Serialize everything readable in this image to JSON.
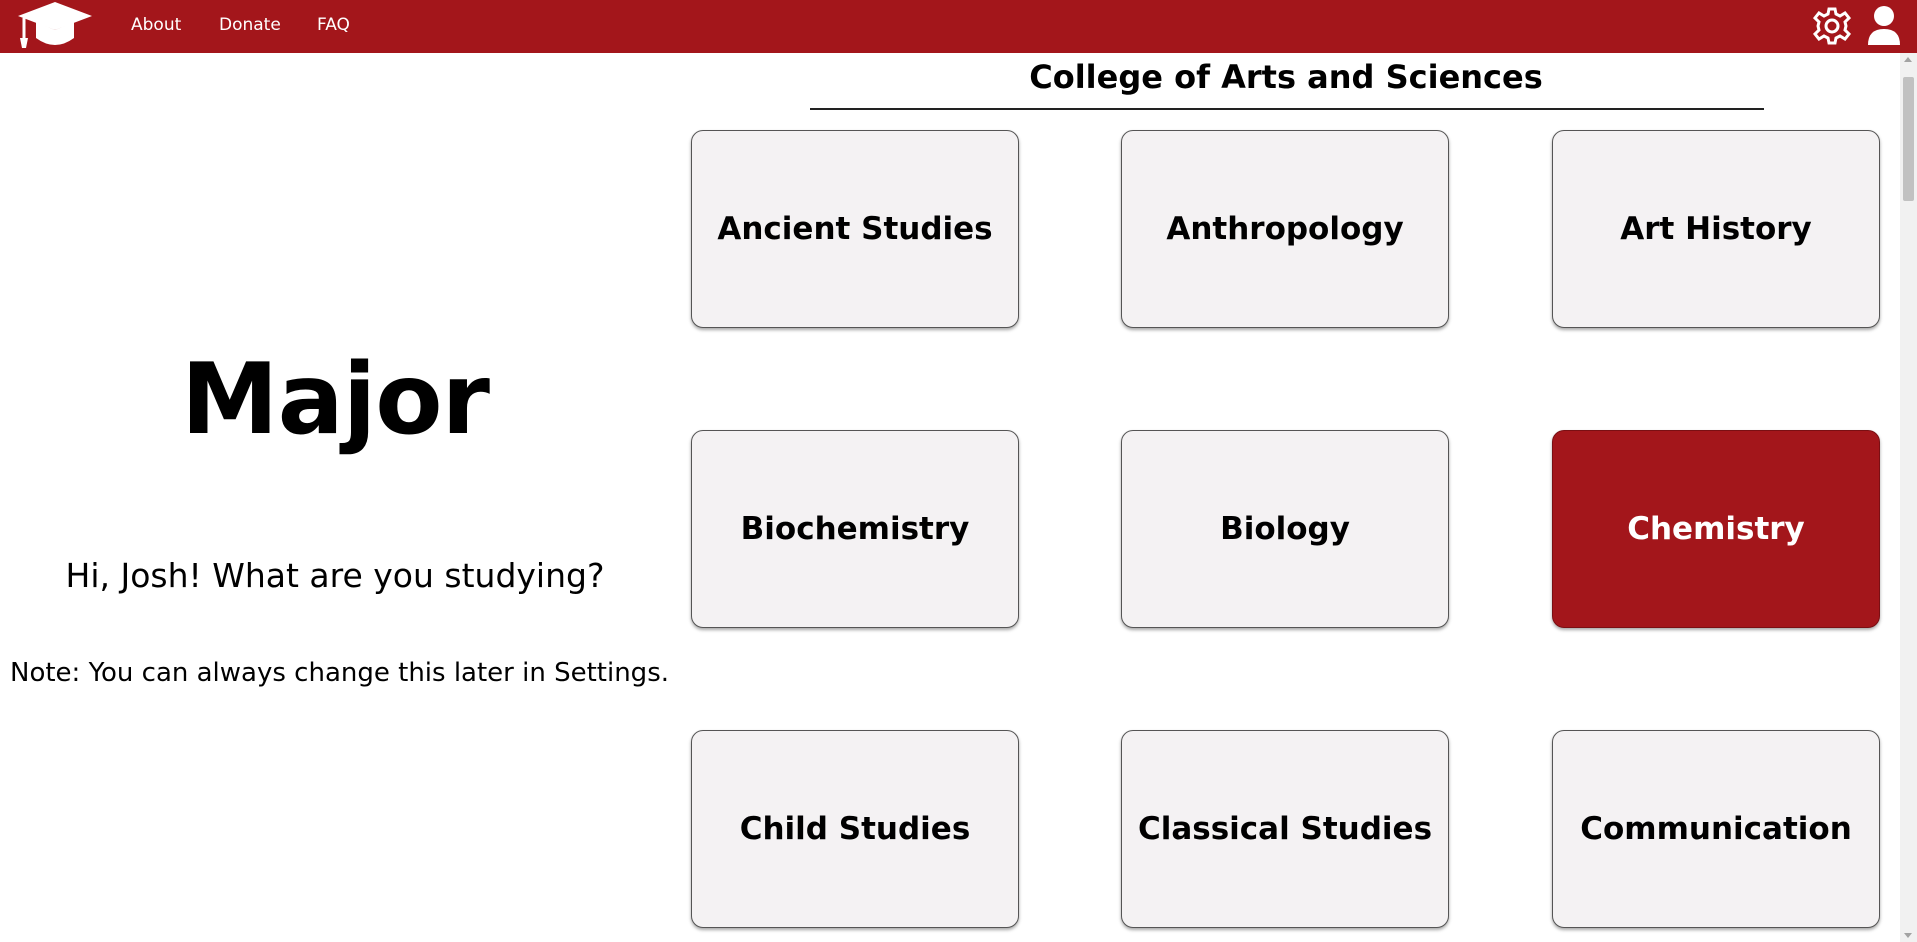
{
  "nav": {
    "logo_icon": "graduation-cap-icon",
    "links": [
      "About",
      "Donate",
      "FAQ"
    ],
    "settings_icon": "gear-icon",
    "account_icon": "user-icon",
    "brand_color": "#a3161b"
  },
  "left": {
    "title": "Major",
    "greeting": "Hi, Josh! What are you studying?",
    "note": "Note: You can always change this later in Settings."
  },
  "section": {
    "title": "College of Arts and Sciences"
  },
  "majors": [
    {
      "label": "Ancient Studies",
      "selected": false
    },
    {
      "label": "Anthropology",
      "selected": false
    },
    {
      "label": "Art History",
      "selected": false
    },
    {
      "label": "Biochemistry",
      "selected": false
    },
    {
      "label": "Biology",
      "selected": false
    },
    {
      "label": "Chemistry",
      "selected": true
    },
    {
      "label": "Child Studies",
      "selected": false
    },
    {
      "label": "Classical Studies",
      "selected": false
    },
    {
      "label": "Communication",
      "selected": false
    }
  ]
}
